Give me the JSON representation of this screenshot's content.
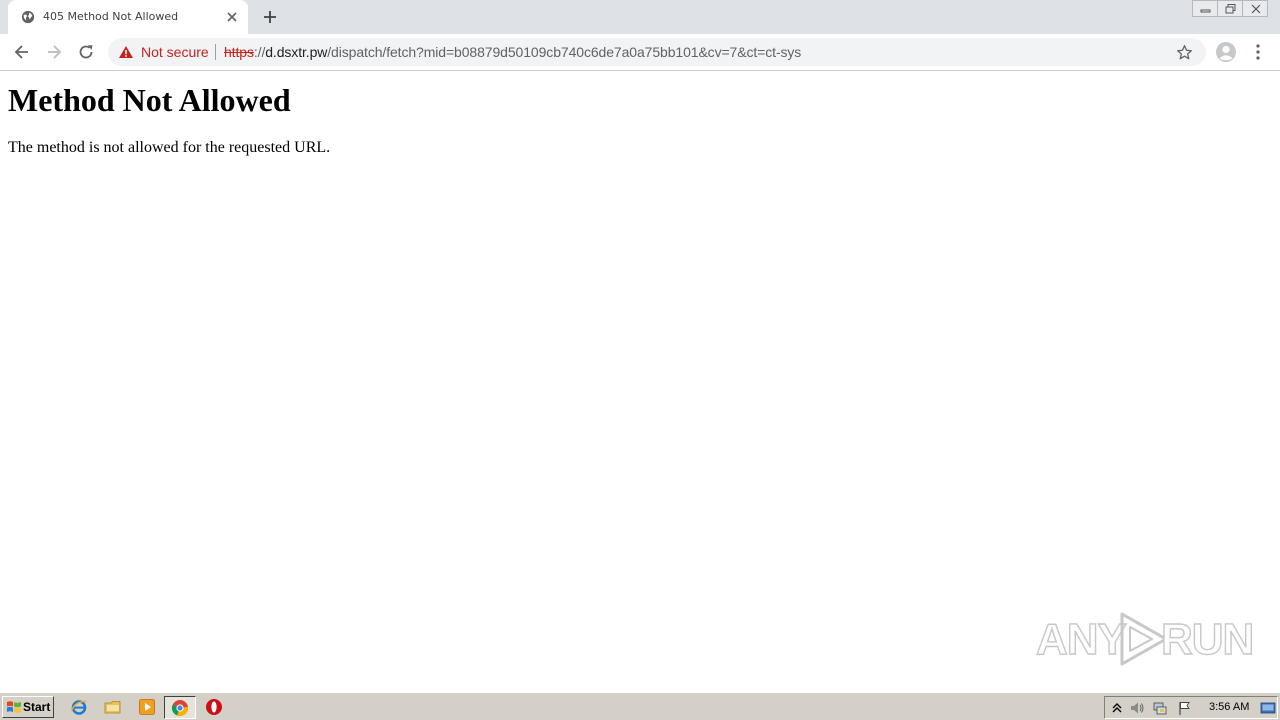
{
  "browser": {
    "tab": {
      "title": "405 Method Not Allowed",
      "favicon": "globe-icon"
    },
    "window_controls": [
      "minimize-icon",
      "restore-icon",
      "close-icon"
    ],
    "security": {
      "label": "Not secure",
      "icon": "warning-icon",
      "color": "#c5221f"
    },
    "url": {
      "scheme": "https",
      "separator": "://",
      "host": "d.dsxtr.pw",
      "path": "/dispatch/fetch?mid=b08879d50109cb740c6de7a0a75bb101&cv=7&ct=ct-sys"
    }
  },
  "page": {
    "heading": "Method Not Allowed",
    "message": "The method is not allowed for the requested URL."
  },
  "watermark": {
    "left": "ANY",
    "right": "RUN"
  },
  "taskbar": {
    "start_label": "Start",
    "pinned": [
      "internet-explorer-icon",
      "folder-icon",
      "media-player-icon",
      "chrome-icon",
      "opera-icon"
    ],
    "tray_icons": [
      "show-hidden-icon",
      "volume-icon",
      "network-icon",
      "action-center-flag-icon",
      "show-desktop-icon"
    ],
    "clock": "3:56 AM"
  }
}
